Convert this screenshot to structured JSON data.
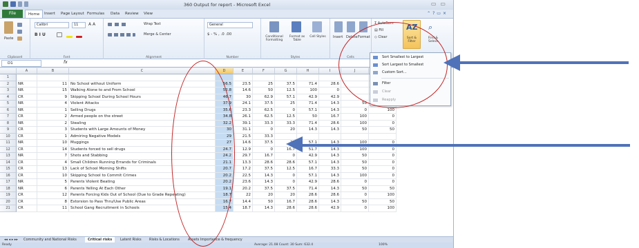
{
  "window": {
    "title": "360 Output for report - Microsoft Excel"
  },
  "tabs": [
    "File",
    "Home",
    "Insert",
    "Page Layout",
    "Formulas",
    "Data",
    "Review",
    "View"
  ],
  "ribbon": {
    "font_name": "Calibri",
    "font_size": "11",
    "wrap_text": "Wrap Text",
    "merge_center": "Merge & Center",
    "number_format": "General",
    "conditional_formatting": "Conditional Formatting",
    "format_as_table": "Format as Table",
    "cell_styles": "Cell Styles",
    "insert": "Insert",
    "delete": "Delete",
    "format": "Format",
    "autosum": "AutoSum",
    "fill": "Fill",
    "clear": "Clear",
    "sort_filter": "Sort & Filter",
    "find_select": "Find & Select",
    "paste": "Paste",
    "groups": [
      "Clipboard",
      "Font",
      "Alignment",
      "Number",
      "Styles",
      "Cells",
      "Editing"
    ]
  },
  "sort_menu": {
    "items": [
      "Sort Smallest to Largest",
      "Sort Largest to Smallest",
      "Custom Sort...",
      "Filter",
      "Clear",
      "Reapply"
    ]
  },
  "formula_bar": {
    "name_box": "D1",
    "fx": "fx"
  },
  "columns": [
    "A",
    "B",
    "C",
    "D",
    "E",
    "F",
    "G",
    "H",
    "I",
    "J",
    "K"
  ],
  "rows": [
    {
      "n": "1",
      "a": "",
      "b": "",
      "c": "",
      "d": "",
      "e": "",
      "f": "",
      "g": "",
      "h": "",
      "i": "",
      "j": "",
      "k": ""
    },
    {
      "n": "2",
      "a": "NR",
      "b": "11",
      "c": "No School without Uniform",
      "d": "56.5",
      "e": "23.5",
      "f": "25",
      "g": "37.5",
      "h": "71.4",
      "i": "28.6",
      "j": "",
      "k": ""
    },
    {
      "n": "3",
      "a": "NR",
      "b": "15",
      "c": "Walking Alone to and From School",
      "d": "52.8",
      "e": "14.6",
      "f": "50",
      "g": "12.5",
      "h": "100",
      "i": "0",
      "j": "",
      "k": ""
    },
    {
      "n": "4",
      "a": "CR",
      "b": "9",
      "c": "Skipping School During School Hours",
      "d": "46.7",
      "e": "30",
      "f": "62.9",
      "g": "57.1",
      "h": "42.9",
      "i": "42.9",
      "j": "",
      "k": ""
    },
    {
      "n": "5",
      "a": "NR",
      "b": "4",
      "c": "Violent Attacks",
      "d": "37.9",
      "e": "24.1",
      "f": "37.5",
      "g": "25",
      "h": "71.4",
      "i": "14.3",
      "j": "50",
      "k": "50"
    },
    {
      "n": "6",
      "a": "NR",
      "b": "1",
      "c": "Selling Drugs",
      "d": "35.6",
      "e": "23.3",
      "f": "62.5",
      "g": "0",
      "h": "57.1",
      "i": "14.3",
      "j": "0",
      "k": "100"
    },
    {
      "n": "7",
      "a": "CR",
      "b": "2",
      "c": "Armed people on the street",
      "d": "34.8",
      "e": "26.1",
      "f": "62.5",
      "g": "12.5",
      "h": "50",
      "i": "16.7",
      "j": "100",
      "k": "0"
    },
    {
      "n": "8",
      "a": "NR",
      "b": "2",
      "c": "Stealing",
      "d": "32.2",
      "e": "39.1",
      "f": "33.3",
      "g": "33.3",
      "h": "71.4",
      "i": "28.6",
      "j": "100",
      "k": "0"
    },
    {
      "n": "9",
      "a": "CR",
      "b": "3",
      "c": "Students with Large Amounts of Money",
      "d": "30",
      "e": "31.1",
      "f": "0",
      "g": "20",
      "h": "14.3",
      "i": "14.3",
      "j": "50",
      "k": "50"
    },
    {
      "n": "10",
      "a": "CR",
      "b": "1",
      "c": "Admiring Negative Models",
      "d": "29",
      "e": "21.5",
      "f": "33.3",
      "g": "",
      "h": "",
      "i": "",
      "j": "",
      "k": ""
    },
    {
      "n": "11",
      "a": "NR",
      "b": "10",
      "c": "Muggings",
      "d": "27",
      "e": "14.6",
      "f": "37.5",
      "g": "25",
      "h": "57.1",
      "i": "14.3",
      "j": "100",
      "k": "0"
    },
    {
      "n": "12",
      "a": "CR",
      "b": "14",
      "c": "Students forced to sell drugs",
      "d": "24.7",
      "e": "12.9",
      "f": "0",
      "g": "16.7",
      "h": "51.7",
      "i": "14.3",
      "j": "100",
      "k": "0"
    },
    {
      "n": "13",
      "a": "NR",
      "b": "7",
      "c": "Shots and Stabbing",
      "d": "24.2",
      "e": "29.7",
      "f": "16.7",
      "g": "0",
      "h": "42.9",
      "i": "14.3",
      "j": "50",
      "k": "0"
    },
    {
      "n": "14",
      "a": "CR",
      "b": "4",
      "c": "Small Children Running Errands for Criminals",
      "d": "21.1",
      "e": "13.3",
      "f": "28.6",
      "g": "28.6",
      "h": "57.1",
      "i": "14.3",
      "j": "50",
      "k": "0"
    },
    {
      "n": "15",
      "a": "CR",
      "b": "13",
      "c": "Lack of School Morning Shifts",
      "d": "20.7",
      "e": "17.2",
      "f": "37.5",
      "g": "12.5",
      "h": "16.7",
      "i": "33.3",
      "j": "50",
      "k": "0"
    },
    {
      "n": "16",
      "a": "CR",
      "b": "10",
      "c": "Skipping School to Commit Crimes",
      "d": "20.2",
      "e": "22.5",
      "f": "14.3",
      "g": "0",
      "h": "57.1",
      "i": "14.3",
      "j": "100",
      "k": "0"
    },
    {
      "n": "17",
      "a": "NR",
      "b": "5",
      "c": "Parents Violent Beating",
      "d": "20.2",
      "e": "23.6",
      "f": "14.3",
      "g": "0",
      "h": "42.9",
      "i": "28.6",
      "j": "0",
      "k": "0"
    },
    {
      "n": "18",
      "a": "NR",
      "b": "6",
      "c": "Parents Yelling At Each Other",
      "d": "19.1",
      "e": "20.2",
      "f": "37.5",
      "g": "37.5",
      "h": "71.4",
      "i": "14.3",
      "j": "50",
      "k": "50"
    },
    {
      "n": "19",
      "a": "CR",
      "b": "12",
      "c": "Parents Forcing Kids Out of School (Due to Grade Repeating)",
      "d": "18.7",
      "e": "22",
      "f": "20",
      "g": "20",
      "h": "28.6",
      "i": "28.6",
      "j": "0",
      "k": "100"
    },
    {
      "n": "20",
      "a": "CR",
      "b": "8",
      "c": "Extorsion to Pass Thru/Use Public Areas",
      "d": "16.7",
      "e": "14.4",
      "f": "50",
      "g": "16.7",
      "h": "28.6",
      "i": "14.3",
      "j": "50",
      "k": "50"
    },
    {
      "n": "21",
      "a": "CR",
      "b": "11",
      "c": "School Gang Recruitment in Schools",
      "d": "15.4",
      "e": "18.7",
      "f": "14.3",
      "g": "28.6",
      "h": "28.6",
      "i": "42.9",
      "j": "0",
      "k": "100"
    }
  ],
  "sheet_tabs": [
    "Community and National Risks",
    "Critical risks",
    "Latent Risks",
    "Risks & Locations",
    "Assets Importance & frequency"
  ],
  "status": {
    "ready": "Ready",
    "summary": "Average: 21.08   Count: 30   Sum: 632.4",
    "zoom": "100%"
  }
}
